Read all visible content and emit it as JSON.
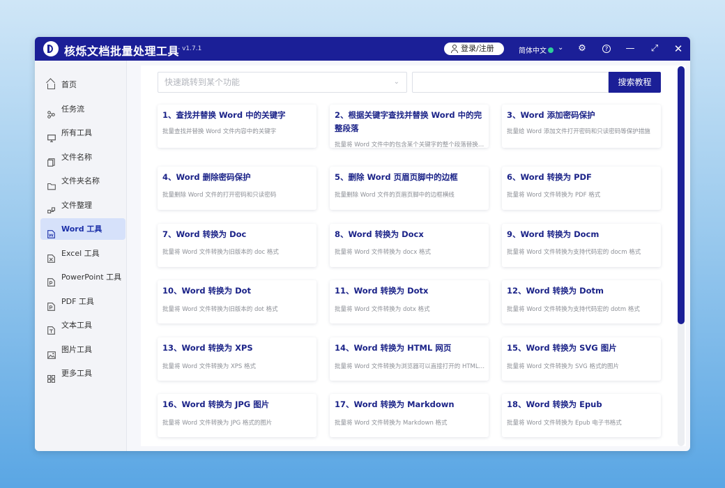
{
  "app": {
    "title": "核烁文档批量处理工具",
    "version": "- v1.7.1",
    "login_label": "登录/注册",
    "language": "简体中文"
  },
  "sidebar": {
    "items": [
      {
        "label": "首页",
        "icon": "home-icon"
      },
      {
        "label": "任务流",
        "icon": "workflow-icon"
      },
      {
        "label": "所有工具",
        "icon": "monitor-icon"
      },
      {
        "label": "文件名称",
        "icon": "file-name-icon"
      },
      {
        "label": "文件夹名称",
        "icon": "folder-icon"
      },
      {
        "label": "文件整理",
        "icon": "organize-icon"
      },
      {
        "label": "Word 工具",
        "icon": "word-icon",
        "active": true
      },
      {
        "label": "Excel 工具",
        "icon": "excel-icon"
      },
      {
        "label": "PowerPoint 工具",
        "icon": "ppt-icon"
      },
      {
        "label": "PDF 工具",
        "icon": "pdf-icon"
      },
      {
        "label": "文本工具",
        "icon": "text-icon"
      },
      {
        "label": "图片工具",
        "icon": "image-icon"
      },
      {
        "label": "更多工具",
        "icon": "more-icon"
      }
    ]
  },
  "search": {
    "placeholder": "快速跳转到某个功能",
    "button_label": "搜索教程"
  },
  "cards": [
    {
      "title": "1、查找并替换 Word 中的关键字",
      "desc": "批量查找并替换 Word 文件内容中的关键字"
    },
    {
      "title": "2、根据关键字查找并替换 Word 中的完整段落",
      "desc": "批量将 Word 文件中的包含某个关键字的整个段落替换为新的内容"
    },
    {
      "title": "3、Word 添加密码保护",
      "desc": "批量给 Word 添加文件打开密码和只读密码等保护措施"
    },
    {
      "title": "4、Word 删除密码保护",
      "desc": "批量删除 Word 文件的打开密码和只读密码"
    },
    {
      "title": "5、删除 Word 页眉页脚中的边框",
      "desc": "批量删除 Word 文件的页眉页脚中的边框横线"
    },
    {
      "title": "6、Word 转换为 PDF",
      "desc": "批量将 Word 文件转换为 PDF 格式"
    },
    {
      "title": "7、Word 转换为 Doc",
      "desc": "批量将 Word 文件转换为旧版本的 doc 格式"
    },
    {
      "title": "8、Word 转换为 Docx",
      "desc": "批量将 Word 文件转换为 docx 格式"
    },
    {
      "title": "9、Word 转换为 Docm",
      "desc": "批量将 Word 文件转换为支持代码宏的 docm 格式"
    },
    {
      "title": "10、Word 转换为 Dot",
      "desc": "批量将 Word 文件转换为旧版本的 dot 格式"
    },
    {
      "title": "11、Word 转换为 Dotx",
      "desc": "批量将 Word 文件转换为 dotx 格式"
    },
    {
      "title": "12、Word 转换为 Dotm",
      "desc": "批量将 Word 文件转换为支持代码宏的 dotm 格式"
    },
    {
      "title": "13、Word 转换为 XPS",
      "desc": "批量将 Word 文件转换为 XPS 格式"
    },
    {
      "title": "14、Word 转换为 HTML 网页",
      "desc": "批量将 Word 文件转换为浏览器可以直接打开的 HTML 网页格式"
    },
    {
      "title": "15、Word 转换为 SVG 图片",
      "desc": "批量将 Word 文件转换为 SVG 格式的图片"
    },
    {
      "title": "16、Word 转换为 JPG 图片",
      "desc": "批量将 Word 文件转换为 JPG 格式的图片"
    },
    {
      "title": "17、Word 转换为 Markdown",
      "desc": "批量将 Word 文件转换为 Markdown 格式"
    },
    {
      "title": "18、Word 转换为 Epub",
      "desc": "批量将 Word 文件转换为 Epub 电子书格式"
    }
  ],
  "colors": {
    "brand": "#1b1f97",
    "active_nav_bg": "#d6e1fa",
    "card_title": "#1b2388"
  }
}
